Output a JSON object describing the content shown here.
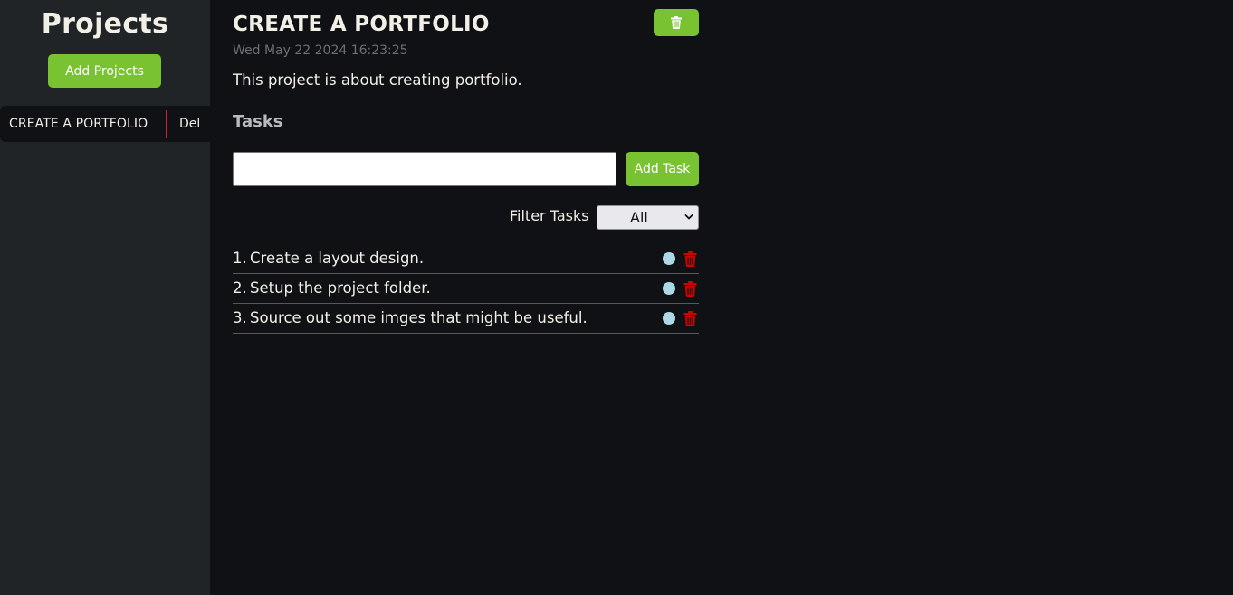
{
  "sidebar": {
    "title": "Projects",
    "add_button_label": "Add Projects",
    "projects": [
      {
        "name": "CREATE A PORTFOLIO",
        "delete_label": "Del"
      }
    ]
  },
  "project": {
    "title": "CREATE A PORTFOLIO",
    "created": "Wed May 22 2024 16:23:25",
    "description": "This project is about creating portfolio.",
    "delete_icon": "trash-icon"
  },
  "tasks": {
    "heading": "Tasks",
    "input_value": "",
    "input_placeholder": "",
    "add_button_label": "Add Task",
    "filter_label": "Filter Tasks",
    "filter_selected": "All",
    "items": [
      {
        "number": "1.",
        "text": "Create a layout design."
      },
      {
        "number": "2.",
        "text": "Setup the project folder."
      },
      {
        "number": "3.",
        "text": "Source out some imges that might be useful."
      }
    ]
  },
  "colors": {
    "accent": "#79c232",
    "sidebar_bg": "#212427",
    "main_bg": "#0f1115",
    "status_dot": "#add8e6",
    "danger": "#d10000"
  }
}
